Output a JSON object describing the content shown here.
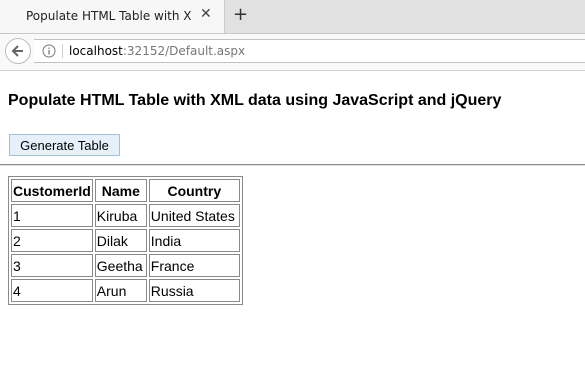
{
  "browser": {
    "tab_title": "Populate HTML Table with X...",
    "url_host": "localhost",
    "url_rest": ":32152/Default.aspx"
  },
  "page": {
    "heading": "Populate HTML Table with XML data using JavaScript and jQuery",
    "button_label": "Generate Table"
  },
  "table": {
    "headers": [
      "CustomerId",
      "Name",
      "Country"
    ],
    "rows": [
      [
        "1",
        "Kiruba",
        "United States"
      ],
      [
        "2",
        "Dilak",
        "India"
      ],
      [
        "3",
        "Geetha",
        "France"
      ],
      [
        "4",
        "Arun",
        "Russia"
      ]
    ]
  }
}
